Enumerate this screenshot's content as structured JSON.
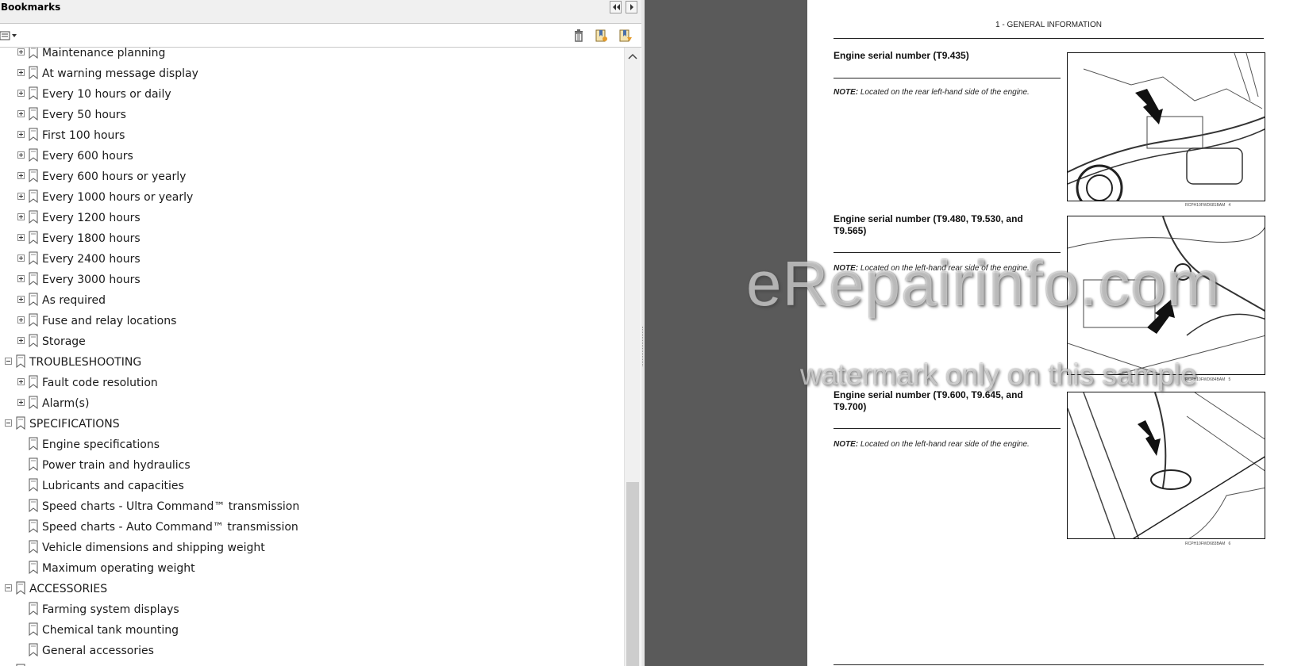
{
  "panel": {
    "title": "Bookmarks",
    "tree": [
      {
        "label": "Maintenance planning",
        "level": 2,
        "expandable": true
      },
      {
        "label": "At warning message display",
        "level": 2,
        "expandable": true
      },
      {
        "label": "Every 10 hours or daily",
        "level": 2,
        "expandable": true
      },
      {
        "label": "Every 50 hours",
        "level": 2,
        "expandable": true
      },
      {
        "label": "First 100 hours",
        "level": 2,
        "expandable": true
      },
      {
        "label": "Every 600 hours",
        "level": 2,
        "expandable": true
      },
      {
        "label": "Every 600 hours or yearly",
        "level": 2,
        "expandable": true
      },
      {
        "label": "Every 1000 hours or yearly",
        "level": 2,
        "expandable": true
      },
      {
        "label": "Every 1200 hours",
        "level": 2,
        "expandable": true
      },
      {
        "label": "Every 1800 hours",
        "level": 2,
        "expandable": true
      },
      {
        "label": "Every 2400 hours",
        "level": 2,
        "expandable": true
      },
      {
        "label": "Every 3000 hours",
        "level": 2,
        "expandable": true
      },
      {
        "label": "As required",
        "level": 2,
        "expandable": true
      },
      {
        "label": "Fuse and relay locations",
        "level": 2,
        "expandable": true
      },
      {
        "label": "Storage",
        "level": 2,
        "expandable": true
      },
      {
        "label": "TROUBLESHOOTING",
        "level": 1,
        "expandable": true,
        "expanded": true
      },
      {
        "label": "Fault code resolution",
        "level": 2,
        "expandable": true
      },
      {
        "label": "Alarm(s)",
        "level": 2,
        "expandable": true
      },
      {
        "label": "SPECIFICATIONS",
        "level": 1,
        "expandable": true,
        "expanded": true
      },
      {
        "label": "Engine specifications",
        "level": 2,
        "expandable": false
      },
      {
        "label": "Power train and hydraulics",
        "level": 2,
        "expandable": false
      },
      {
        "label": "Lubricants and capacities",
        "level": 2,
        "expandable": false
      },
      {
        "label": "Speed charts - Ultra Command™ transmission",
        "level": 2,
        "expandable": false
      },
      {
        "label": "Speed charts - Auto Command™ transmission",
        "level": 2,
        "expandable": false
      },
      {
        "label": "Vehicle dimensions and shipping weight",
        "level": 2,
        "expandable": false
      },
      {
        "label": "Maximum operating weight",
        "level": 2,
        "expandable": false
      },
      {
        "label": "ACCESSORIES",
        "level": 1,
        "expandable": true,
        "expanded": true
      },
      {
        "label": "Farming system displays",
        "level": 2,
        "expandable": false
      },
      {
        "label": "Chemical tank mounting",
        "level": 2,
        "expandable": false
      },
      {
        "label": "General accessories",
        "level": 2,
        "expandable": false
      },
      {
        "label": "",
        "level": 1,
        "expandable": true,
        "expanded": true
      }
    ]
  },
  "document": {
    "header": "1 - GENERAL INFORMATION",
    "sections": [
      {
        "title_lines": [
          "Engine serial number (T9.435)"
        ],
        "note_prefix": "NOTE:",
        "note": " Located on the rear left-hand side of the engine.",
        "figure_code": "RCPH10FWD681BAM",
        "figure_number": "4"
      },
      {
        "title_lines": [
          "Engine serial number (T9.480, T9.530, and",
          "T9.565)"
        ],
        "note_prefix": "NOTE:",
        "note": " Located on the left-hand rear side of the engine.",
        "figure_code": "RCPH10FWD684BAM",
        "figure_number": "5"
      },
      {
        "title_lines": [
          "Engine serial number (T9.600, T9.645, and",
          "T9.700)"
        ],
        "note_prefix": "NOTE:",
        "note": " Located on the left-hand rear side of the engine.",
        "figure_code": "RCPH10FWD683BAM",
        "figure_number": "6"
      }
    ],
    "watermark_main": "eRepairinfo.com",
    "watermark_sub": "watermark only on this sample"
  },
  "colors": {
    "panel_bg": "#ffffff",
    "doc_bg": "#5a5a5a",
    "text": "#1a1a1a"
  },
  "icons": [
    "options-icon",
    "delete-bookmark-icon",
    "new-bookmark-icon",
    "expand-bookmark-icon",
    "bookmark-icon",
    "collapse-arrow-icon",
    "expand-arrow-icon"
  ]
}
